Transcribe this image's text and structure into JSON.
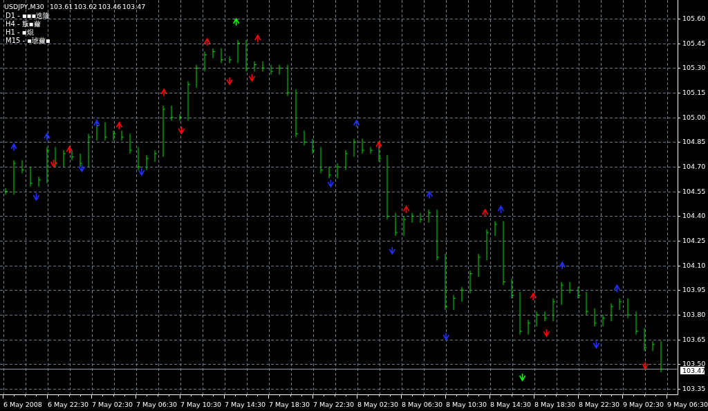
{
  "chart": {
    "symbol": "USDJPY,M30",
    "ohlc": [
      "103.61",
      "103.62",
      "103.46",
      "103.47"
    ],
    "indicator_lines": [
      "D1 - ▪▪▪迭隆",
      "H4 - 叛▪薾",
      "H1 - ▪焜",
      "M15 - ▪琥薾▪"
    ],
    "current_price": "103.47",
    "price_axis": [
      "105.60",
      "105.45",
      "105.30",
      "105.15",
      "105.00",
      "104.85",
      "104.70",
      "104.55",
      "104.40",
      "104.25",
      "104.10",
      "103.95",
      "103.80",
      "103.65",
      "103.50",
      "103.35"
    ],
    "time_axis": [
      "6 May 2008",
      "6 May 22:30",
      "7 May 02:30",
      "7 May 06:30",
      "7 May 10:30",
      "7 May 14:30",
      "7 May 18:30",
      "7 May 22:30",
      "8 May 02:30",
      "8 May 06:30",
      "8 May 10:30",
      "8 May 14:30",
      "8 May 18:30",
      "8 May 22:30",
      "9 May 02:30",
      "9 May 06:30"
    ]
  }
}
